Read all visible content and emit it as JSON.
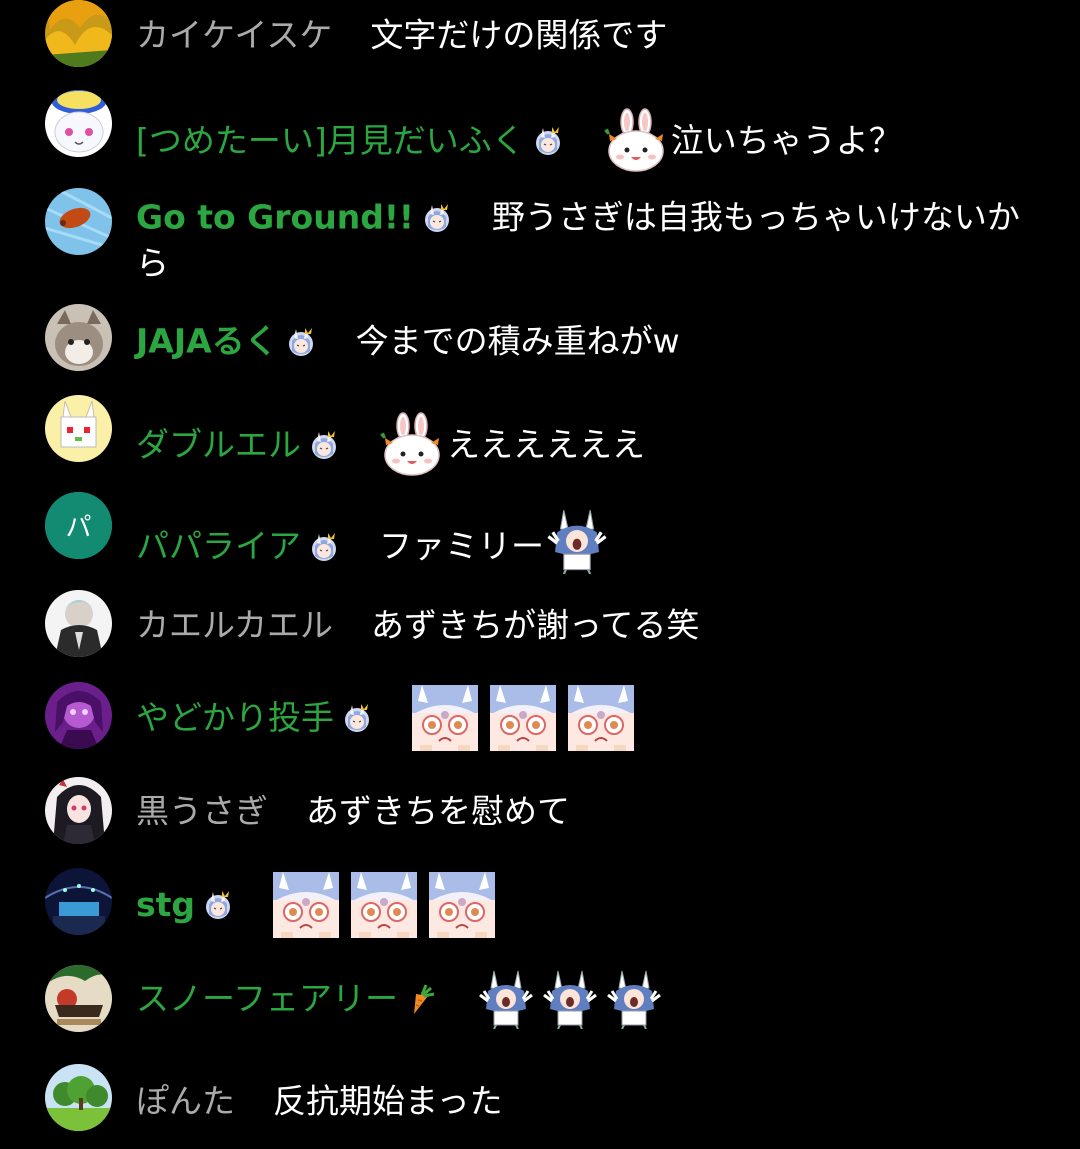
{
  "messages": [
    {
      "author": "カイケイスケ",
      "text": "文字だけの関係です"
    },
    {
      "author": "[つめたーい]月見だいふく",
      "text": "泣いちゃうよ？"
    },
    {
      "author": "Go to Ground!!",
      "text": "野うさぎは自我もっちゃいけないから"
    },
    {
      "author": "JAJAるく",
      "text": "今までの積み重ねがw"
    },
    {
      "author": "ダブルエル",
      "text": "ええええええ"
    },
    {
      "author": "パパライア",
      "avatar_letter": "パ",
      "text": "ファミリー"
    },
    {
      "author": "カエルカエル",
      "text": "あずきちが謝ってる笑"
    },
    {
      "author": "やどかり投手",
      "text": ""
    },
    {
      "author": "黒うさぎ",
      "text": "あずきちを慰めて"
    },
    {
      "author": "stg",
      "text": ""
    },
    {
      "author": "スノーフェアリー",
      "text": ""
    },
    {
      "author": "ぽんた",
      "text": "反抗期始まった"
    }
  ],
  "colors": {
    "background": "#000000",
    "member_name": "#2ba640",
    "plain_name": "#aaaaaa",
    "message_text": "#ffffff",
    "avatar_letter_bg": "#138a72"
  },
  "icons": {
    "member_badge": "bunny-girl-badge-icon",
    "carrot_badge": "carrot-badge-icon",
    "bunny_face_emote": "bunny-face-emote-icon",
    "crying_face_emote": "crying-face-emote-icon",
    "peko_cheer_emote": "peko-cheer-emote-icon"
  }
}
